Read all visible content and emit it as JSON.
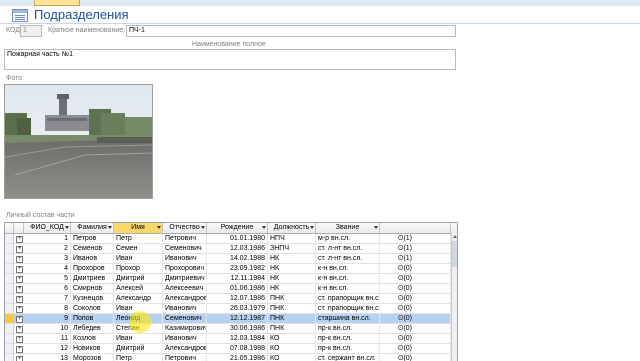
{
  "form": {
    "title": "Подразделения",
    "id_label": "КОД:",
    "id_value": "1",
    "short_name_label": "Краткое наименование:",
    "short_name_value": "ПЧ-1",
    "full_name_label": "Наименование полное",
    "full_name_value": "Пожарная часть №1",
    "photo_label": "Фото",
    "personnel_label": "Личный состав части"
  },
  "grid": {
    "columns": [
      "ФИО_КОД",
      "Фамилия",
      "Имя",
      "Отчество",
      "Рождение",
      "Должность",
      "Звание"
    ],
    "attachment_header_icon": "paperclip-icon",
    "sorted_column": "Имя",
    "selected_row_index": 8,
    "rows": [
      {
        "id": "1",
        "last": "Петров",
        "first": "Петр",
        "middle": "Петрович",
        "birth": "01.01.1980",
        "position": "НПЧ",
        "rank": "м-р вн.сл.",
        "att": "(1)"
      },
      {
        "id": "2",
        "last": "Семенов",
        "first": "Семен",
        "middle": "Семенович",
        "birth": "12.03.1986",
        "position": "ЗНПЧ",
        "rank": "ст. л-нт вн.сл.",
        "att": "(1)"
      },
      {
        "id": "3",
        "last": "Иванов",
        "first": "Иван",
        "middle": "Иванович",
        "birth": "14.02.1988",
        "position": "НК",
        "rank": "ст. л-нт вн.сл.",
        "att": "(1)"
      },
      {
        "id": "4",
        "last": "Прохоров",
        "first": "Прохор",
        "middle": "Прохорович",
        "birth": "23.09.1982",
        "position": "НК",
        "rank": "к-н вн.сл.",
        "att": "(0)"
      },
      {
        "id": "5",
        "last": "Дмитриев",
        "first": "Дмитрий",
        "middle": "Дмитриевич",
        "birth": "12.11.1984",
        "position": "НК",
        "rank": "к-н вн.сл.",
        "att": "(0)"
      },
      {
        "id": "6",
        "last": "Смирнов",
        "first": "Алексей",
        "middle": "Алексеевич",
        "birth": "01.06.1986",
        "position": "НК",
        "rank": "к-н вн.сл.",
        "att": "(0)"
      },
      {
        "id": "7",
        "last": "Кузнецов",
        "first": "Александр",
        "middle": "Александрович",
        "birth": "12.07.1986",
        "position": "ПНК",
        "rank": "ст. прапорщик вн.сл.",
        "att": "(0)"
      },
      {
        "id": "8",
        "last": "Соколов",
        "first": "Иван",
        "middle": "Иванович",
        "birth": "26.03.1979",
        "position": "ПНК",
        "rank": "ст. прапорщик вн.сл.",
        "att": "(0)"
      },
      {
        "id": "9",
        "last": "Попов",
        "first": "Леонид",
        "middle": "Семенович",
        "birth": "12.12.1987",
        "position": "ПНК",
        "rank": "старшина вн.сл.",
        "att": "(0)"
      },
      {
        "id": "10",
        "last": "Лебедев",
        "first": "Степан",
        "middle": "Казимирович",
        "birth": "30.06.1986",
        "position": "ПНК",
        "rank": "пр-к вн.сл.",
        "att": "(0)"
      },
      {
        "id": "11",
        "last": "Козлов",
        "first": "Иван",
        "middle": "Иванович",
        "birth": "12.03.1984",
        "position": "КО",
        "rank": "пр-к вн.сл.",
        "att": "(0)"
      },
      {
        "id": "12",
        "last": "Новиков",
        "first": "Дмитрий",
        "middle": "Александрович",
        "birth": "07.08.1988",
        "position": "КО",
        "rank": "пр-к вн.сл.",
        "att": "(0)"
      },
      {
        "id": "13",
        "last": "Морозов",
        "first": "Петр",
        "middle": "Петрович",
        "birth": "21.05.1986",
        "position": "КО",
        "rank": "ст. сержант вн.сл.",
        "att": "(0)"
      }
    ]
  },
  "colors": {
    "title": "#1f4e96",
    "selected_row": "#b6d1f2",
    "sorted_header": "#f9d86b"
  }
}
